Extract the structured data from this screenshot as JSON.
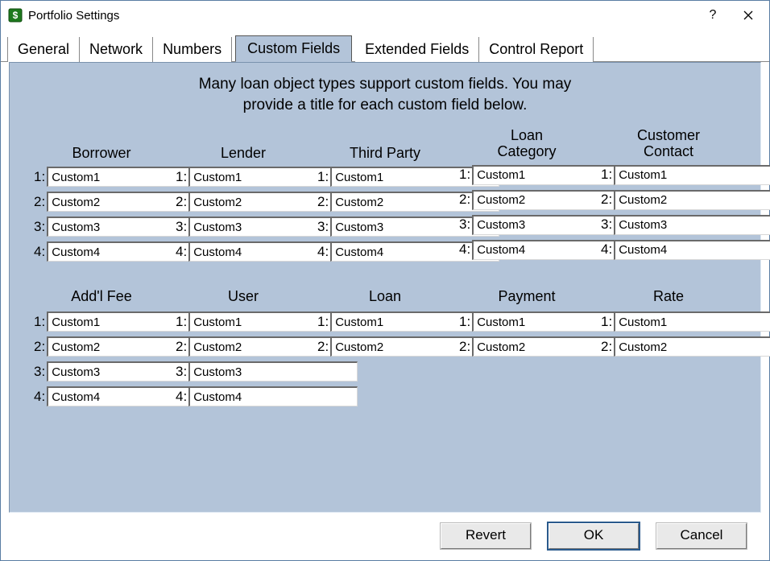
{
  "window": {
    "title": "Portfolio Settings"
  },
  "tabs": {
    "general": "General",
    "network": "Network",
    "numbers": "Numbers",
    "custom_fields": "Custom Fields",
    "extended_fields": "Extended Fields",
    "control_report": "Control Report"
  },
  "intro": {
    "line1": "Many loan object types support custom fields.  You may",
    "line2": "provide a title for each custom field below."
  },
  "groups_row1": {
    "borrower": {
      "title": "Borrower",
      "f1": "Custom1",
      "f2": "Custom2",
      "f3": "Custom3",
      "f4": "Custom4"
    },
    "lender": {
      "title": "Lender",
      "f1": "Custom1",
      "f2": "Custom2",
      "f3": "Custom3",
      "f4": "Custom4"
    },
    "third_party": {
      "title": "Third Party",
      "f1": "Custom1",
      "f2": "Custom2",
      "f3": "Custom3",
      "f4": "Custom4"
    },
    "loan_category": {
      "title": "Loan\nCategory",
      "f1": "Custom1",
      "f2": "Custom2",
      "f3": "Custom3",
      "f4": "Custom4"
    },
    "customer_contact": {
      "title": "Customer\nContact",
      "f1": "Custom1",
      "f2": "Custom2",
      "f3": "Custom3",
      "f4": "Custom4"
    }
  },
  "groups_row2": {
    "addl_fee": {
      "title": "Add'l Fee",
      "f1": "Custom1",
      "f2": "Custom2",
      "f3": "Custom3",
      "f4": "Custom4"
    },
    "user": {
      "title": "User",
      "f1": "Custom1",
      "f2": "Custom2",
      "f3": "Custom3",
      "f4": "Custom4"
    },
    "loan": {
      "title": "Loan",
      "f1": "Custom1",
      "f2": "Custom2"
    },
    "payment": {
      "title": "Payment",
      "f1": "Custom1",
      "f2": "Custom2"
    },
    "rate": {
      "title": "Rate",
      "f1": "Custom1",
      "f2": "Custom2"
    }
  },
  "labels": {
    "n1": "1:",
    "n2": "2:",
    "n3": "3:",
    "n4": "4:"
  },
  "buttons": {
    "revert": "Revert",
    "ok": "OK",
    "cancel": "Cancel"
  }
}
